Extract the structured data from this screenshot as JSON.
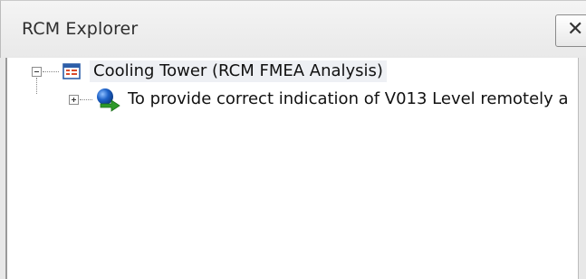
{
  "panel": {
    "title": "RCM Explorer",
    "close_glyph": "✕"
  },
  "tree": {
    "root": {
      "label": "Cooling Tower (RCM FMEA Analysis)",
      "icon": "table-icon",
      "expanded": true
    },
    "children": [
      {
        "label": "To provide correct indication of V013 Level remotely a",
        "icon": "function-icon",
        "expanded": false
      }
    ]
  },
  "colors": {
    "root_icon_border": "#2d5ea8",
    "root_icon_fill": "#d94a2b",
    "function_icon_blue": "#1f63c9",
    "function_icon_green": "#2e9a2a",
    "selection_bg": "#eef0f4"
  }
}
